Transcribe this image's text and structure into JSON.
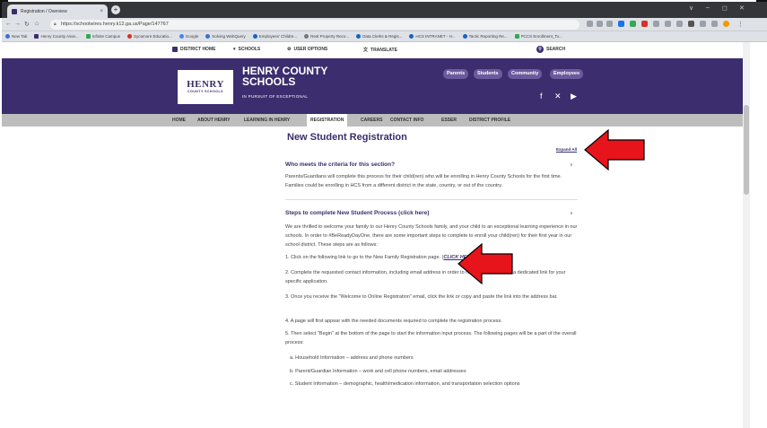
{
  "browser": {
    "tab_title": "Registration / Overview",
    "tab_close": "×",
    "new_tab": "+",
    "url": "https://schoolwires.henry.k12.ga.us/Page/147767",
    "window_controls": [
      "∨",
      "–",
      "◻",
      "✕"
    ],
    "bookmarks": [
      "New Tab",
      "Henry County Asse...",
      "Infinite Campus",
      "Sycamore Educatio...",
      "Google",
      "Solving WebQuery",
      "Employees' Childre...",
      "Real Property Reco...",
      "Data Clerks & Regis...",
      "HCS INTRANET - H...",
      "Tactic Reporting Re...",
      "PCCS Enrollment_To..."
    ]
  },
  "utility_bar": {
    "district_home": "DISTRICT HOME",
    "schools": "SCHOOLS",
    "user_options": "USER OPTIONS",
    "translate": "TRANSLATE",
    "search": "SEARCH"
  },
  "banner": {
    "logo_main": "HENRY",
    "logo_sub": "COUNTY SCHOOLS",
    "school_name_1": "HENRY COUNTY",
    "school_name_2": "SCHOOLS",
    "tagline": "IN PURSUIT OF EXCEPTIONAL",
    "audience_buttons": [
      "Parents",
      "Students",
      "Community",
      "Employees"
    ],
    "background_color": "#3b2d6e"
  },
  "main_nav": {
    "items": [
      "HOME",
      "ABOUT HENRY",
      "LEARNING IN HENRY",
      "REGISTRATION",
      "CAREERS",
      "CONTACT INFO",
      "ESSER",
      "DISTRICT PROFILE"
    ],
    "active": "REGISTRATION"
  },
  "content": {
    "page_title": "New Student Registration",
    "expand_all": "Expand All",
    "section1_title": "Who meets the criteria for this section?",
    "section1_body": "Parents/Guardians will complete this process for their child(ren) who will be enrolling in Henry County Schools for the first time. Families could be enrolling in HCS from a different district in the state, country, or out of the country.",
    "section2_title": "Steps to complete New Student Process (click here)",
    "intro": "We are thrilled to welcome your family to our Henry County Schools family, and your child to an exceptional learning experience in our schools. In order to #BeReadyDayOne, there are some important steps to complete to enroll your child(ren) for their first year in our school district. These steps are as follows:",
    "step1_text": "1. Click on the following link to go to the New Family Registration page. (",
    "step1_link": "CLICK HERE",
    "step1_end": ")",
    "step2": "2. Complete the requested contact information, including email address in order to receive an email with a dedicated link for your specific application.",
    "step3": "3. Once you receive the \"Welcome to Online Registration\" email, click the link or copy and paste the link into the address bar.",
    "step4": "4. A page will first appear with the needed documents required to complete the registration process.",
    "step5": "5. Then select \"Begin\" at the bottom of the page to start the information input process. The following pages will be a part of the overall process:",
    "sub_a": "a. Household Information – address and phone numbers",
    "sub_b": "b. Parent/Guardian Information – work and cell phone numbers, email addresses",
    "sub_c": "c. Student Information – demographic, health/medication information, and transportation selection options"
  },
  "annotation": {
    "arrow_color": "#e8141b"
  }
}
